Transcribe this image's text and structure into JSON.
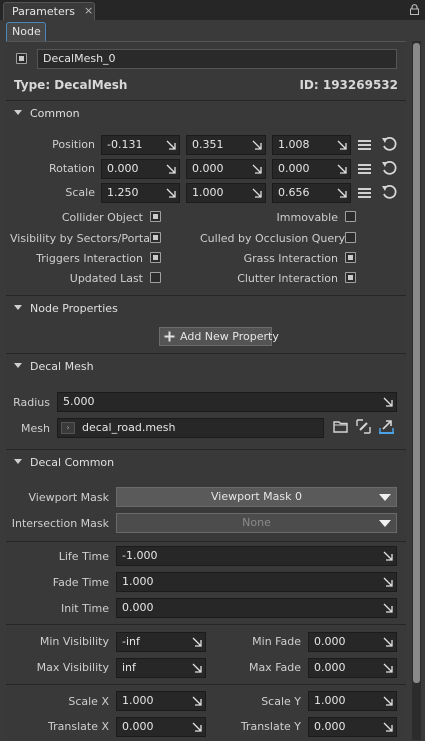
{
  "window": {
    "tab_title": "Parameters",
    "close_glyph": "×",
    "inner_tab": "Node"
  },
  "node": {
    "name": "DecalMesh_0",
    "type_label": "Type: DecalMesh",
    "id_label": "ID: 193269532",
    "enabled": true
  },
  "common": {
    "title": "Common",
    "rows": [
      {
        "label": "Position",
        "values": [
          "-0.131",
          "0.351",
          "1.008"
        ]
      },
      {
        "label": "Rotation",
        "values": [
          "0.000",
          "0.000",
          "0.000"
        ]
      },
      {
        "label": "Scale",
        "values": [
          "1.250",
          "1.000",
          "0.656"
        ]
      }
    ],
    "flags_left": [
      {
        "label": "Collider Object",
        "checked": true
      },
      {
        "label": "Visibility by Sectors/Portals",
        "checked": true
      },
      {
        "label": "Triggers Interaction",
        "checked": true
      },
      {
        "label": "Updated Last",
        "checked": false
      }
    ],
    "flags_right": [
      {
        "label": "Immovable",
        "checked": false
      },
      {
        "label": "Culled by Occlusion Query",
        "checked": false
      },
      {
        "label": "Grass Interaction",
        "checked": true
      },
      {
        "label": "Clutter Interaction",
        "checked": true
      }
    ]
  },
  "node_properties": {
    "title": "Node Properties",
    "add_button": "Add New Property"
  },
  "decal_mesh": {
    "title": "Decal Mesh",
    "radius_label": "Radius",
    "radius_value": "5.000",
    "mesh_label": "Mesh",
    "mesh_value": "decal_road.mesh"
  },
  "decal_common": {
    "title": "Decal Common",
    "viewport_mask_label": "Viewport Mask",
    "viewport_mask_value": "Viewport Mask 0",
    "intersection_mask_label": "Intersection Mask",
    "intersection_mask_value": "None",
    "life_time_label": "Life Time",
    "life_time_value": "-1.000",
    "fade_time_label": "Fade Time",
    "fade_time_value": "1.000",
    "init_time_label": "Init Time",
    "init_time_value": "0.000",
    "min_visibility_label": "Min Visibility",
    "min_visibility_value": "-inf",
    "max_visibility_label": "Max Visibility",
    "max_visibility_value": "inf",
    "min_fade_label": "Min Fade",
    "min_fade_value": "0.000",
    "max_fade_label": "Max Fade",
    "max_fade_value": "0.000",
    "scale_x_label": "Scale X",
    "scale_x_value": "1.000",
    "scale_y_label": "Scale Y",
    "scale_y_value": "1.000",
    "translate_x_label": "Translate X",
    "translate_x_value": "0.000",
    "translate_y_label": "Translate Y",
    "translate_y_value": "0.000"
  },
  "icons": {
    "field_arrow": "expand-arrow-icon",
    "menu": "menu-icon",
    "reset": "reset-icon",
    "lock": "lock-icon",
    "folder": "folder-icon",
    "edit": "edit-icon",
    "jump": "jump-to-icon"
  }
}
